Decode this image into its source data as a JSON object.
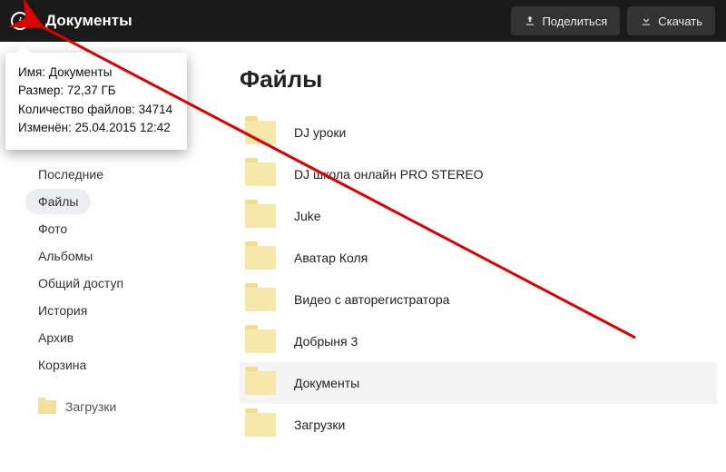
{
  "header": {
    "title": "Документы",
    "share_label": "Поделиться",
    "download_label": "Скачать"
  },
  "tooltip": {
    "name_label": "Имя:",
    "name_value": "Документы",
    "size_label": "Размер:",
    "size_value": "72,37 ГБ",
    "count_label": "Количество файлов:",
    "count_value": "34714",
    "modified_label": "Изменён:",
    "modified_value": "25.04.2015 12:42"
  },
  "sidebar": {
    "items": [
      {
        "label": "Последние",
        "active": false
      },
      {
        "label": "Файлы",
        "active": true
      },
      {
        "label": "Фото",
        "active": false
      },
      {
        "label": "Альбомы",
        "active": false
      },
      {
        "label": "Общий доступ",
        "active": false
      },
      {
        "label": "История",
        "active": false
      },
      {
        "label": "Архив",
        "active": false
      },
      {
        "label": "Корзина",
        "active": false
      }
    ],
    "sub_label": "Загрузки"
  },
  "main": {
    "heading": "Файлы",
    "files": [
      {
        "name": "DJ уроки"
      },
      {
        "name": "DJ школа онлайн PRO STEREO"
      },
      {
        "name": "Juke"
      },
      {
        "name": "Аватар Коля"
      },
      {
        "name": "Видео с авторегистратора"
      },
      {
        "name": "Добрыня 3"
      },
      {
        "name": "Документы"
      },
      {
        "name": "Загрузки"
      }
    ],
    "highlight_index": 6
  }
}
